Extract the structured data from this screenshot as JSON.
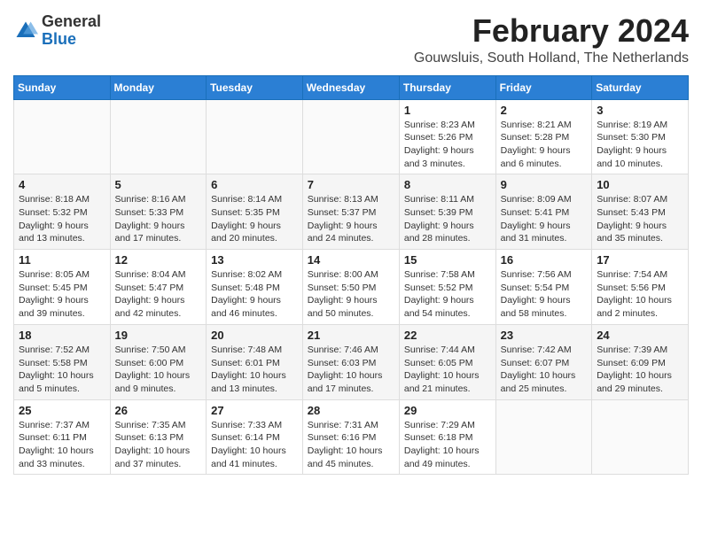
{
  "header": {
    "logo_general": "General",
    "logo_blue": "Blue",
    "month_year": "February 2024",
    "location": "Gouwsluis, South Holland, The Netherlands"
  },
  "weekdays": [
    "Sunday",
    "Monday",
    "Tuesday",
    "Wednesday",
    "Thursday",
    "Friday",
    "Saturday"
  ],
  "weeks": [
    [
      {
        "day": "",
        "detail": ""
      },
      {
        "day": "",
        "detail": ""
      },
      {
        "day": "",
        "detail": ""
      },
      {
        "day": "",
        "detail": ""
      },
      {
        "day": "1",
        "detail": "Sunrise: 8:23 AM\nSunset: 5:26 PM\nDaylight: 9 hours\nand 3 minutes."
      },
      {
        "day": "2",
        "detail": "Sunrise: 8:21 AM\nSunset: 5:28 PM\nDaylight: 9 hours\nand 6 minutes."
      },
      {
        "day": "3",
        "detail": "Sunrise: 8:19 AM\nSunset: 5:30 PM\nDaylight: 9 hours\nand 10 minutes."
      }
    ],
    [
      {
        "day": "4",
        "detail": "Sunrise: 8:18 AM\nSunset: 5:32 PM\nDaylight: 9 hours\nand 13 minutes."
      },
      {
        "day": "5",
        "detail": "Sunrise: 8:16 AM\nSunset: 5:33 PM\nDaylight: 9 hours\nand 17 minutes."
      },
      {
        "day": "6",
        "detail": "Sunrise: 8:14 AM\nSunset: 5:35 PM\nDaylight: 9 hours\nand 20 minutes."
      },
      {
        "day": "7",
        "detail": "Sunrise: 8:13 AM\nSunset: 5:37 PM\nDaylight: 9 hours\nand 24 minutes."
      },
      {
        "day": "8",
        "detail": "Sunrise: 8:11 AM\nSunset: 5:39 PM\nDaylight: 9 hours\nand 28 minutes."
      },
      {
        "day": "9",
        "detail": "Sunrise: 8:09 AM\nSunset: 5:41 PM\nDaylight: 9 hours\nand 31 minutes."
      },
      {
        "day": "10",
        "detail": "Sunrise: 8:07 AM\nSunset: 5:43 PM\nDaylight: 9 hours\nand 35 minutes."
      }
    ],
    [
      {
        "day": "11",
        "detail": "Sunrise: 8:05 AM\nSunset: 5:45 PM\nDaylight: 9 hours\nand 39 minutes."
      },
      {
        "day": "12",
        "detail": "Sunrise: 8:04 AM\nSunset: 5:47 PM\nDaylight: 9 hours\nand 42 minutes."
      },
      {
        "day": "13",
        "detail": "Sunrise: 8:02 AM\nSunset: 5:48 PM\nDaylight: 9 hours\nand 46 minutes."
      },
      {
        "day": "14",
        "detail": "Sunrise: 8:00 AM\nSunset: 5:50 PM\nDaylight: 9 hours\nand 50 minutes."
      },
      {
        "day": "15",
        "detail": "Sunrise: 7:58 AM\nSunset: 5:52 PM\nDaylight: 9 hours\nand 54 minutes."
      },
      {
        "day": "16",
        "detail": "Sunrise: 7:56 AM\nSunset: 5:54 PM\nDaylight: 9 hours\nand 58 minutes."
      },
      {
        "day": "17",
        "detail": "Sunrise: 7:54 AM\nSunset: 5:56 PM\nDaylight: 10 hours\nand 2 minutes."
      }
    ],
    [
      {
        "day": "18",
        "detail": "Sunrise: 7:52 AM\nSunset: 5:58 PM\nDaylight: 10 hours\nand 5 minutes."
      },
      {
        "day": "19",
        "detail": "Sunrise: 7:50 AM\nSunset: 6:00 PM\nDaylight: 10 hours\nand 9 minutes."
      },
      {
        "day": "20",
        "detail": "Sunrise: 7:48 AM\nSunset: 6:01 PM\nDaylight: 10 hours\nand 13 minutes."
      },
      {
        "day": "21",
        "detail": "Sunrise: 7:46 AM\nSunset: 6:03 PM\nDaylight: 10 hours\nand 17 minutes."
      },
      {
        "day": "22",
        "detail": "Sunrise: 7:44 AM\nSunset: 6:05 PM\nDaylight: 10 hours\nand 21 minutes."
      },
      {
        "day": "23",
        "detail": "Sunrise: 7:42 AM\nSunset: 6:07 PM\nDaylight: 10 hours\nand 25 minutes."
      },
      {
        "day": "24",
        "detail": "Sunrise: 7:39 AM\nSunset: 6:09 PM\nDaylight: 10 hours\nand 29 minutes."
      }
    ],
    [
      {
        "day": "25",
        "detail": "Sunrise: 7:37 AM\nSunset: 6:11 PM\nDaylight: 10 hours\nand 33 minutes."
      },
      {
        "day": "26",
        "detail": "Sunrise: 7:35 AM\nSunset: 6:13 PM\nDaylight: 10 hours\nand 37 minutes."
      },
      {
        "day": "27",
        "detail": "Sunrise: 7:33 AM\nSunset: 6:14 PM\nDaylight: 10 hours\nand 41 minutes."
      },
      {
        "day": "28",
        "detail": "Sunrise: 7:31 AM\nSunset: 6:16 PM\nDaylight: 10 hours\nand 45 minutes."
      },
      {
        "day": "29",
        "detail": "Sunrise: 7:29 AM\nSunset: 6:18 PM\nDaylight: 10 hours\nand 49 minutes."
      },
      {
        "day": "",
        "detail": ""
      },
      {
        "day": "",
        "detail": ""
      }
    ]
  ]
}
